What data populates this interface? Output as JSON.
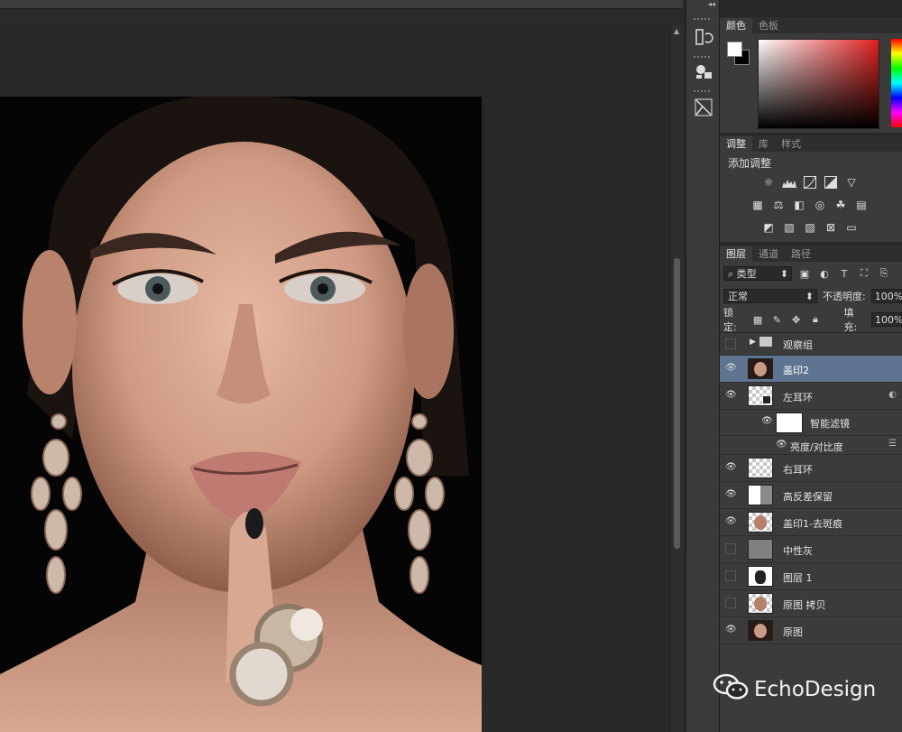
{
  "top_collapse_icon": "double-chevron-left-icon",
  "color_panel": {
    "tabs": [
      "颜色",
      "色板"
    ],
    "foreground": "#ffffff",
    "background": "#000000"
  },
  "adjustments_panel": {
    "tabs": [
      "调整",
      "库",
      "样式"
    ],
    "title": "添加调整",
    "row1_icons": [
      "brightness-contrast-icon",
      "levels-icon",
      "curves-icon",
      "exposure-icon",
      "vibrance-icon"
    ],
    "row2_icons": [
      "hue-saturation-icon",
      "color-balance-icon",
      "black-white-icon",
      "photo-filter-icon",
      "channel-mixer-icon",
      "color-lookup-icon"
    ],
    "row3_icons": [
      "invert-icon",
      "posterize-icon",
      "threshold-icon",
      "selective-color-icon",
      "gradient-map-icon"
    ]
  },
  "layers_panel": {
    "tabs": [
      "图层",
      "通道",
      "路径"
    ],
    "filter_kind": "类型",
    "blend_mode": "正常",
    "opacity_label": "不透明度:",
    "opacity_value": "100%",
    "lock_label": "锁定:",
    "fill_label": "填充:",
    "fill_value": "100%",
    "layers": [
      {
        "name": "观察组",
        "visible": false,
        "type": "group"
      },
      {
        "name": "盖印2",
        "visible": true,
        "type": "photo",
        "selected": true
      },
      {
        "name": "左耳环",
        "visible": true,
        "type": "smart"
      },
      {
        "name": "智能滤镜",
        "visible": true,
        "type": "filter-mask"
      },
      {
        "name": "亮度/对比度",
        "visible": true,
        "type": "filter"
      },
      {
        "name": "右耳环",
        "visible": true,
        "type": "transparent"
      },
      {
        "name": "高反差保留",
        "visible": true,
        "type": "transparent"
      },
      {
        "name": "盖印1-去斑痕",
        "visible": true,
        "type": "photo"
      },
      {
        "name": "中性灰",
        "visible": false,
        "type": "gray"
      },
      {
        "name": "图层 1",
        "visible": false,
        "type": "mask"
      },
      {
        "name": "原图 拷贝",
        "visible": false,
        "type": "photo"
      },
      {
        "name": "原图",
        "visible": true,
        "type": "photo"
      }
    ]
  },
  "watermark": {
    "text": "EchoDesign",
    "icon": "wechat-icon"
  }
}
